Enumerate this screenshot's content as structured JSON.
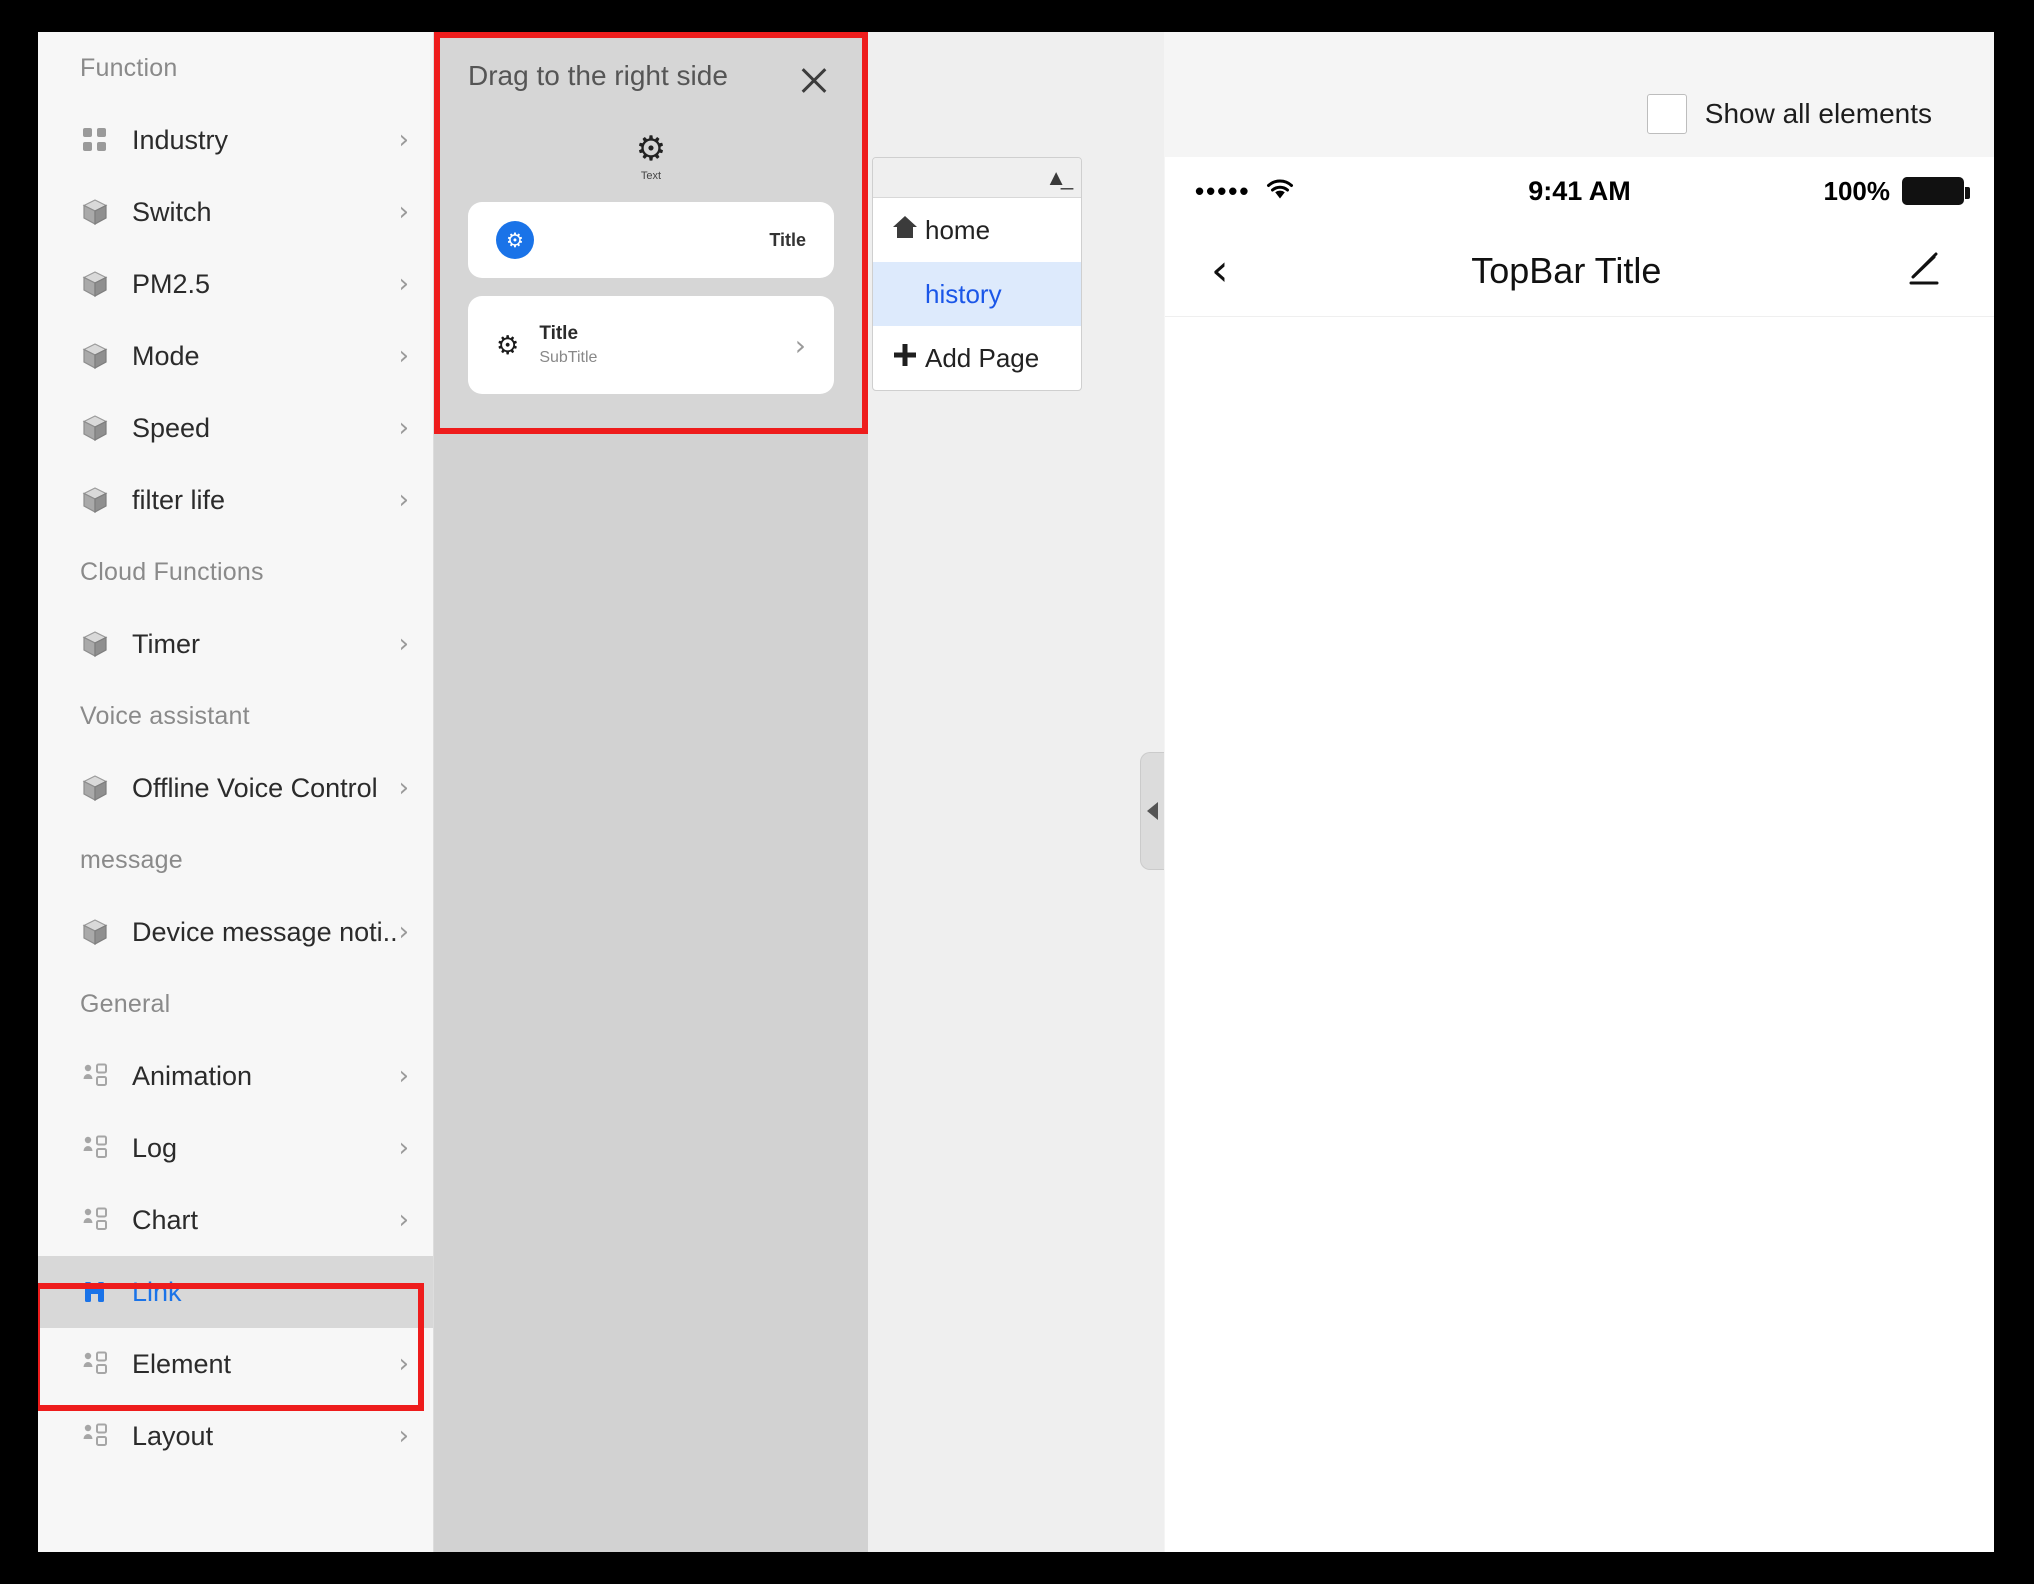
{
  "sidebar": {
    "groups": [
      {
        "title": "Function",
        "items": [
          {
            "label": "Industry",
            "icon": "grid-icon",
            "chevron": "›"
          },
          {
            "label": "Switch",
            "icon": "cube-icon",
            "chevron": "›"
          },
          {
            "label": "PM2.5",
            "icon": "cube-icon",
            "chevron": "›"
          },
          {
            "label": "Mode",
            "icon": "cube-icon",
            "chevron": "›"
          },
          {
            "label": "Speed",
            "icon": "cube-icon",
            "chevron": "›"
          },
          {
            "label": "filter life",
            "icon": "cube-icon",
            "chevron": "›"
          }
        ]
      },
      {
        "title": "Cloud Functions",
        "items": [
          {
            "label": "Timer",
            "icon": "cube-icon",
            "chevron": "›"
          }
        ]
      },
      {
        "title": "Voice assistant",
        "items": [
          {
            "label": "Offline Voice Control",
            "icon": "cube-icon",
            "chevron": "›"
          }
        ]
      },
      {
        "title": "message",
        "items": [
          {
            "label": "Device message noti...",
            "icon": "cube-icon",
            "chevron": "›"
          }
        ]
      },
      {
        "title": "General",
        "items": [
          {
            "label": "Animation",
            "icon": "people-icon",
            "chevron": "›"
          },
          {
            "label": "Log",
            "icon": "people-icon",
            "chevron": "›"
          },
          {
            "label": "Chart",
            "icon": "people-icon",
            "chevron": "›"
          },
          {
            "label": "Link",
            "icon": "link-icon",
            "chevron": "",
            "active": true
          },
          {
            "label": "Element",
            "icon": "people-icon",
            "chevron": "›"
          },
          {
            "label": "Layout",
            "icon": "people-icon",
            "chevron": "›"
          }
        ]
      }
    ]
  },
  "drag_panel": {
    "title": "Drag to the right side",
    "close_icon": "close-icon",
    "text_chip": {
      "icon": "gear-hex-icon",
      "caption": "Text"
    },
    "cards": [
      {
        "icon": "blue-gear-icon",
        "right_title": "Title"
      },
      {
        "icon": "gear-hex-icon",
        "title": "Title",
        "subtitle": "SubTitle",
        "arrow": "›"
      }
    ]
  },
  "page_list": {
    "collapse_icon": "collapse-up-icon",
    "items": [
      {
        "label": "home",
        "icon": "home-icon",
        "selected": false
      },
      {
        "label": "history",
        "icon": "",
        "selected": true
      },
      {
        "label": "Add Page",
        "icon": "plus-icon",
        "selected": false
      }
    ]
  },
  "middle": {
    "handle_icon": "triangle-left-icon"
  },
  "preview": {
    "show_all": {
      "label": "Show all elements",
      "checked": false
    },
    "status_bar": {
      "signal": "•••••",
      "wifi_icon": "wifi-icon",
      "time": "9:41 AM",
      "battery_percent": "100%",
      "battery_icon": "battery-full-icon"
    },
    "top_bar": {
      "back_icon": "chevron-left-icon",
      "title": "TopBar Title",
      "edit_icon": "pencil-icon"
    }
  },
  "colors": {
    "accent_blue": "#1a73e8",
    "highlight_red": "#ee1c1c",
    "selected_row_bg": "#d8d8d8",
    "page_selected_bg": "#ddeafc"
  }
}
